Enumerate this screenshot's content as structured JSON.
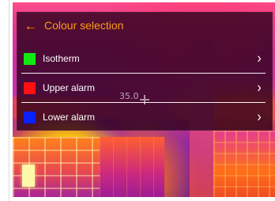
{
  "header": {
    "back_icon": "←",
    "title": "Colour selection"
  },
  "menu": {
    "items": [
      {
        "label": "Isotherm",
        "color": "#12e812",
        "chevron": "›"
      },
      {
        "label": "Upper alarm",
        "color": "#ff1111",
        "chevron": "›"
      },
      {
        "label": "Lower alarm",
        "color": "#0b20ff",
        "chevron": "›"
      }
    ]
  },
  "measurement": {
    "value": "35.0"
  },
  "colors": {
    "accent": "#ff9b16",
    "panel": "#270018",
    "divider": "#ffffff"
  }
}
